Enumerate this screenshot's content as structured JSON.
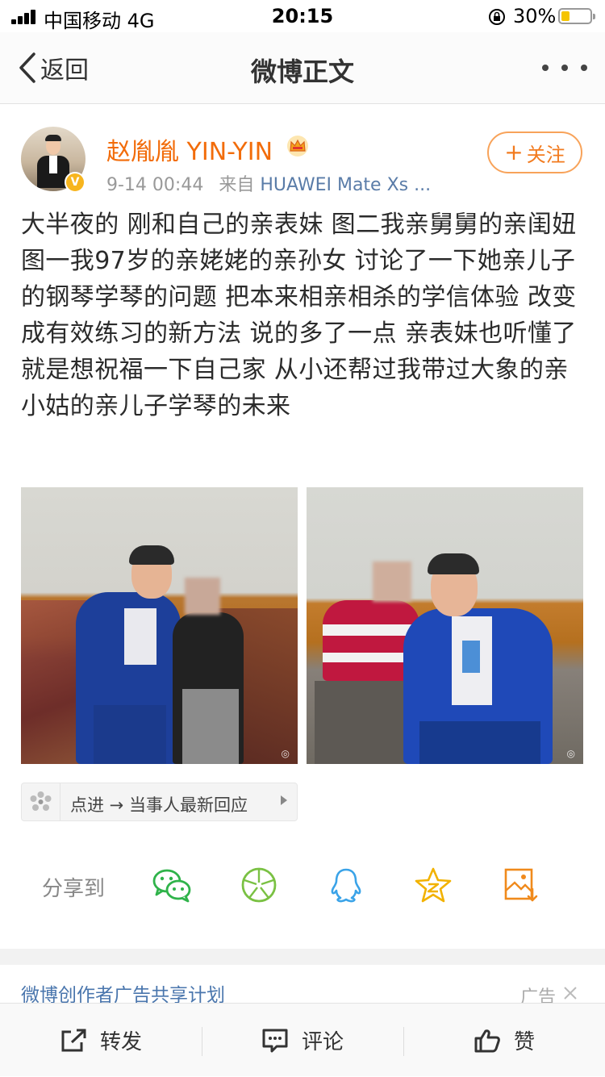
{
  "status_bar": {
    "carrier": "中国移动 4G",
    "time": "20:15",
    "battery": "30%"
  },
  "nav": {
    "back_label": "返回",
    "title": "微博正文"
  },
  "author": {
    "name": "赵胤胤 YIN-YIN",
    "time": "9-14 00:44",
    "source_prefix": "来自",
    "source": "HUAWEI Mate Xs ...",
    "follow_label": "关注"
  },
  "post": {
    "text": "大半夜的 刚和自己的亲表妹 图二我亲舅舅的亲闺妞 图一我97岁的亲姥姥的亲孙女 讨论了一下她亲儿子的钢琴学琴的问题 把本来相亲相杀的学信体验 改变成有效练习的新方法 说的多了一点 亲表妹也听懂了 就是想祝福一下自己家 从小还帮过我带过大象的亲小姑的亲儿子学琴的未来"
  },
  "reply_strip": {
    "text": "点进 → 当事人最新回应"
  },
  "share": {
    "label": "分享到",
    "targets": [
      "wechat-icon",
      "moments-icon",
      "qq-icon",
      "qzone-icon",
      "save-image-icon"
    ]
  },
  "ad": {
    "title": "微博创作者广告共享计划",
    "label": "广告"
  },
  "bottom_bar": {
    "repost": "转发",
    "comment": "评论",
    "like": "赞"
  },
  "colors": {
    "author_name": "#f26c0a",
    "follow": "#f27b1f",
    "link": "#4a76ad",
    "share_green": "#2fb34a",
    "share_blue": "#3aa3e8",
    "share_yellow": "#f2b200",
    "share_orange": "#f08a1c"
  }
}
